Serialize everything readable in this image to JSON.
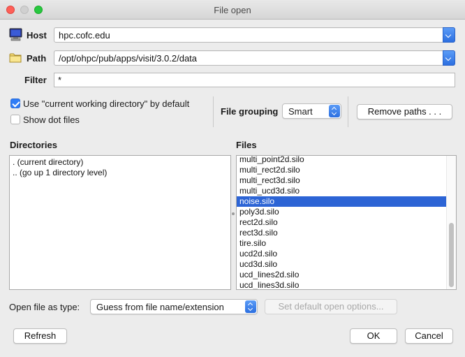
{
  "window": {
    "title": "File open"
  },
  "host": {
    "label": "Host",
    "value": "hpc.cofc.edu"
  },
  "path": {
    "label": "Path",
    "value": "/opt/ohpc/pub/apps/visit/3.0.2/data"
  },
  "filter": {
    "label": "Filter",
    "value": "*"
  },
  "options": {
    "use_cwd_label": "Use \"current working directory\" by default",
    "use_cwd_checked": true,
    "show_dot_label": "Show dot files",
    "show_dot_checked": false
  },
  "grouping": {
    "label": "File grouping",
    "value": "Smart"
  },
  "remove_paths_label": "Remove paths . . .",
  "directories": {
    "header": "Directories",
    "items": [
      ". (current directory)",
      ".. (go up 1 directory level)"
    ]
  },
  "files": {
    "header": "Files",
    "items": [
      "multi_point2d.silo",
      "multi_rect2d.silo",
      "multi_rect3d.silo",
      "multi_ucd3d.silo",
      "noise.silo",
      "poly3d.silo",
      "rect2d.silo",
      "rect3d.silo",
      "tire.silo",
      "ucd2d.silo",
      "ucd3d.silo",
      "ucd_lines2d.silo",
      "ucd_lines3d.silo"
    ],
    "selected": "noise.silo"
  },
  "open_as": {
    "label": "Open file as type:",
    "value": "Guess from file name/extension"
  },
  "set_default_label": "Set default open options...",
  "buttons": {
    "refresh": "Refresh",
    "ok": "OK",
    "cancel": "Cancel"
  },
  "colors": {
    "accent": "#2c64d5",
    "close": "#fe5f57",
    "maximize": "#28c840"
  },
  "icons": {
    "host": "computer-icon",
    "path": "folder-icon"
  }
}
